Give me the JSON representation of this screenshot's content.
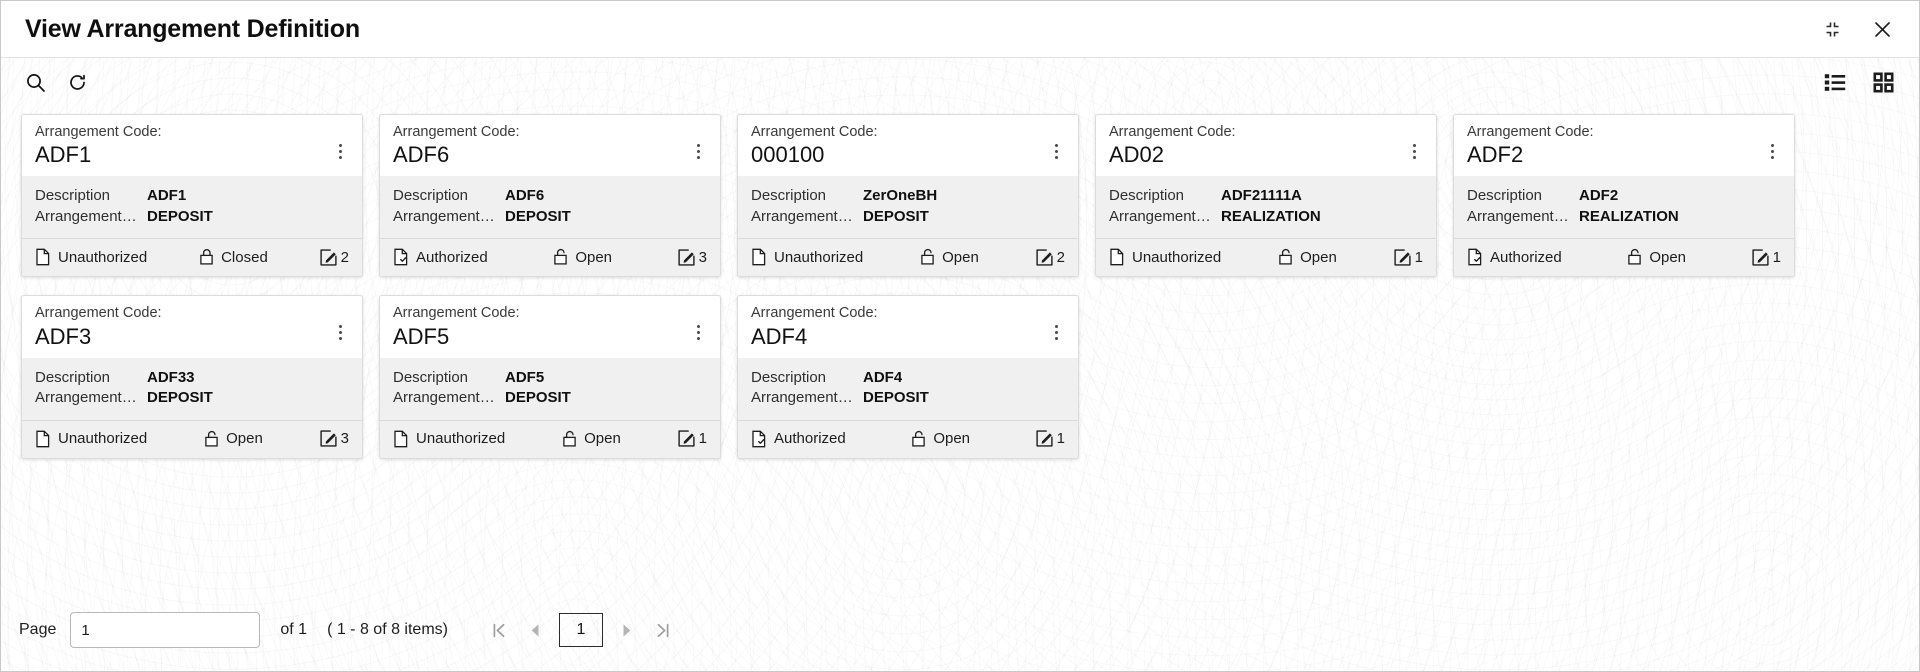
{
  "window": {
    "title": "View Arrangement Definition",
    "collapse_icon": "collapse-icon",
    "close_icon": "close-icon"
  },
  "toolbar": {
    "search_icon": "search-icon",
    "refresh_icon": "refresh-icon",
    "list_view_icon": "list-view-icon",
    "grid_view_icon": "grid-view-icon"
  },
  "card_labels": {
    "code_label": "Arrangement Code:",
    "description_key": "Description",
    "type_key": "Arrangement…",
    "menu_icon": "kebab-menu-icon",
    "doc_icon": "document-icon",
    "lock_icon": "lock-icon",
    "edit_icon": "edit-icon"
  },
  "cards": [
    {
      "code": "ADF1",
      "description": "ADF1",
      "type": "DEPOSIT",
      "auth": "Unauthorized",
      "state": "Closed",
      "count": "2",
      "auth_state": "unauthorized",
      "lock_state": "closed"
    },
    {
      "code": "ADF6",
      "description": "ADF6",
      "type": "DEPOSIT",
      "auth": "Authorized",
      "state": "Open",
      "count": "3",
      "auth_state": "authorized",
      "lock_state": "open"
    },
    {
      "code": "000100",
      "description": "ZerOneBH",
      "type": "DEPOSIT",
      "auth": "Unauthorized",
      "state": "Open",
      "count": "2",
      "auth_state": "unauthorized",
      "lock_state": "open"
    },
    {
      "code": "AD02",
      "description": "ADF21111A",
      "type": "REALIZATION",
      "auth": "Unauthorized",
      "state": "Open",
      "count": "1",
      "auth_state": "unauthorized",
      "lock_state": "open"
    },
    {
      "code": "ADF2",
      "description": "ADF2",
      "type": "REALIZATION",
      "auth": "Authorized",
      "state": "Open",
      "count": "1",
      "auth_state": "authorized",
      "lock_state": "open"
    },
    {
      "code": "ADF3",
      "description": "ADF33",
      "type": "DEPOSIT",
      "auth": "Unauthorized",
      "state": "Open",
      "count": "3",
      "auth_state": "unauthorized",
      "lock_state": "open"
    },
    {
      "code": "ADF5",
      "description": "ADF5",
      "type": "DEPOSIT",
      "auth": "Unauthorized",
      "state": "Open",
      "count": "1",
      "auth_state": "unauthorized",
      "lock_state": "open"
    },
    {
      "code": "ADF4",
      "description": "ADF4",
      "type": "DEPOSIT",
      "auth": "Authorized",
      "state": "Open",
      "count": "1",
      "auth_state": "authorized",
      "lock_state": "open"
    }
  ],
  "pagination": {
    "page_label": "Page",
    "page_value": "1",
    "page_placeholder": "",
    "of_text": "of 1",
    "items_text": "( 1 - 8 of 8 items)",
    "first_icon": "first-page-icon",
    "prev_icon": "prev-page-icon",
    "current_page": "1",
    "next_icon": "next-page-icon",
    "last_icon": "last-page-icon"
  },
  "colors": {
    "card_body": "#f0f0f0",
    "card_header": "#ffffff",
    "card_border": "#dcdcdc",
    "text": "#1c1c1c",
    "muted": "#9e9e9e"
  }
}
